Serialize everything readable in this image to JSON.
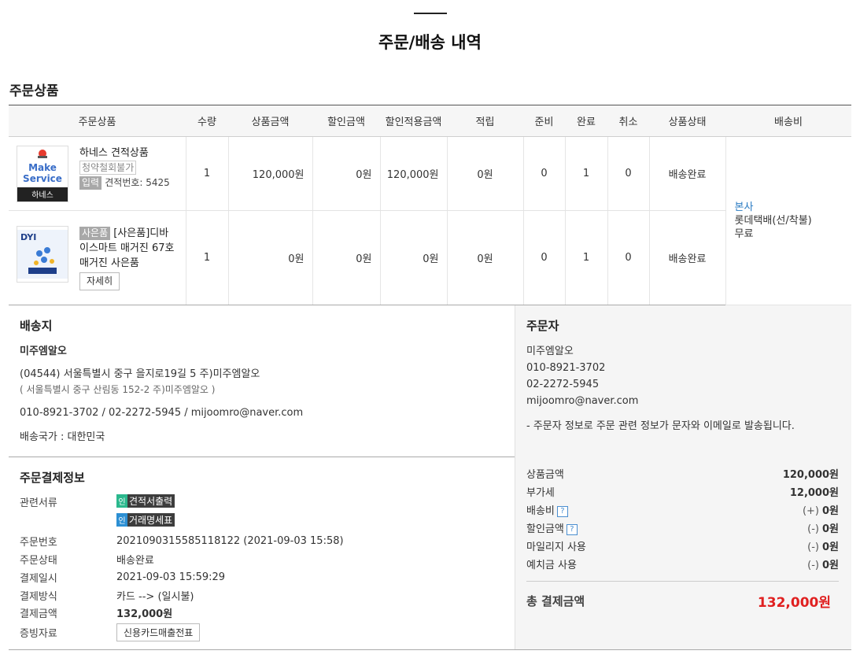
{
  "page": {
    "title": "주문/배송 내역"
  },
  "items_section": {
    "label": "주문상품"
  },
  "table": {
    "headers": [
      "주문상품",
      "수량",
      "상품금액",
      "할인금액",
      "할인적용금액",
      "적립",
      "준비",
      "완료",
      "취소",
      "상품상태",
      "배송비"
    ],
    "rows": [
      {
        "thumb": {
          "line1": "Make",
          "line2": "Service",
          "caption": "하네스"
        },
        "name": "하네스 견적상품",
        "tag": "청약철회불가",
        "input_badge": "입력",
        "note": "견적번호: 5425",
        "qty": "1",
        "price": "120,000원",
        "discount": "0원",
        "discounted": "120,000원",
        "points": "0원",
        "ready": "0",
        "done": "1",
        "cancel": "0",
        "status": "배송완료"
      },
      {
        "thumb": {
          "logo": "DYI"
        },
        "gift_badge": "사은품",
        "name": "[사은품]디바이스마트 매거진 67호",
        "sub": "매거진 사은품",
        "detail_btn": "자세히",
        "qty": "1",
        "price": "0원",
        "discount": "0원",
        "discounted": "0원",
        "points": "0원",
        "ready": "0",
        "done": "1",
        "cancel": "0",
        "status": "배송완료"
      }
    ],
    "shipping": {
      "origin": "본사",
      "method": "롯데택배(선/착불)",
      "fee": "무료"
    }
  },
  "delivery": {
    "heading": "배송지",
    "name": "미주엠알오",
    "address": "(04544) 서울특별시 중구 을지로19길 5 주)미주엠알오",
    "address_old": "( 서울특별시 중구 산림동 152-2 주)미주엠알오 )",
    "contacts": "010-8921-3702 / 02-2272-5945 / mijoomro@naver.com",
    "country": "배송국가 : 대한민국"
  },
  "orderer": {
    "heading": "주문자",
    "name": "미주엠알오",
    "mobile": "010-8921-3702",
    "phone": "02-2272-5945",
    "email": "mijoomro@naver.com",
    "notice": "- 주문자 정보로 주문 관련 정보가 문자와 이메일로 발송됩니다."
  },
  "payment": {
    "heading": "주문결제정보",
    "docs_label": "관련서류",
    "doc1": "견적서출력",
    "doc2": "거래명세표",
    "doc_icon": "인",
    "fields": [
      {
        "k": "주문번호",
        "v": "2021090315585118122 (2021-09-03 15:58)"
      },
      {
        "k": "주문상태",
        "v": "배송완료"
      },
      {
        "k": "결제일시",
        "v": "2021-09-03 15:59:29"
      },
      {
        "k": "결제방식",
        "v": "카드 --> (일시불)"
      },
      {
        "k": "결제금액",
        "v": "132,000원"
      }
    ],
    "proof_label": "증빙자료",
    "proof_btn": "신용카드매출전표"
  },
  "summary": {
    "lines": [
      {
        "k": "상품금액",
        "pre": "",
        "v": "120,000원",
        "help": false
      },
      {
        "k": "부가세",
        "pre": "",
        "v": "12,000원",
        "help": false
      },
      {
        "k": "배송비",
        "pre": "(+)",
        "v": "0원",
        "help": true
      },
      {
        "k": "할인금액",
        "pre": "(-)",
        "v": "0원",
        "help": true
      },
      {
        "k": "마일리지 사용",
        "pre": "(-)",
        "v": "0원",
        "help": false
      },
      {
        "k": "예치금 사용",
        "pre": "(-)",
        "v": "0원",
        "help": false
      }
    ],
    "help_mark": "?",
    "total_label": "총 결제금액",
    "total_value": "132,000원"
  },
  "colors": {
    "accent_red": "#e02020",
    "link_blue": "#2a7bc2",
    "doc_green": "#2bb88d",
    "doc_blue": "#2c8fd3"
  }
}
